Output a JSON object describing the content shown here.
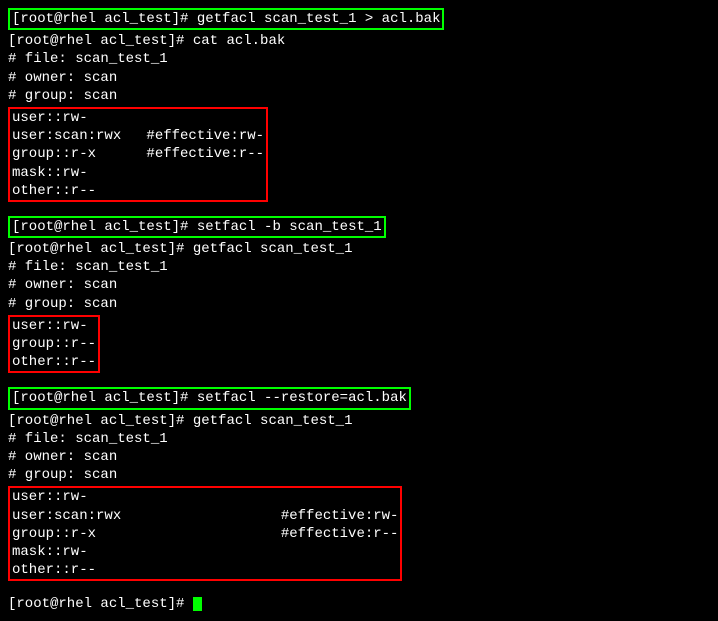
{
  "prompt": "[root@rhel acl_test]# ",
  "section1": {
    "cmd1": "getfacl scan_test_1 > acl.bak",
    "cmd2": "cat acl.bak",
    "header_file": "# file: scan_test_1",
    "header_owner": "# owner: scan",
    "header_group": "# group: scan",
    "acl_line1": "user::rw-",
    "acl_line2": "user:scan:rwx   #effective:rw-",
    "acl_line3": "group::r-x      #effective:r--",
    "acl_line4": "mask::rw-",
    "acl_line5": "other::r--"
  },
  "section2": {
    "cmd1": "setfacl -b scan_test_1",
    "cmd2": "getfacl scan_test_1",
    "header_file": "# file: scan_test_1",
    "header_owner": "# owner: scan",
    "header_group": "# group: scan",
    "acl_line1": "user::rw-",
    "acl_line2": "group::r--",
    "acl_line3": "other::r--"
  },
  "section3": {
    "cmd1": "setfacl --restore=acl.bak",
    "cmd2": "getfacl scan_test_1",
    "header_file": "# file: scan_test_1",
    "header_owner": "# owner: scan",
    "header_group": "# group: scan",
    "acl_line1": "user::rw-",
    "acl_line2": "user:scan:rwx                   #effective:rw-",
    "acl_line3": "group::r-x                      #effective:r--",
    "acl_line4": "mask::rw-",
    "acl_line5": "other::r--"
  }
}
